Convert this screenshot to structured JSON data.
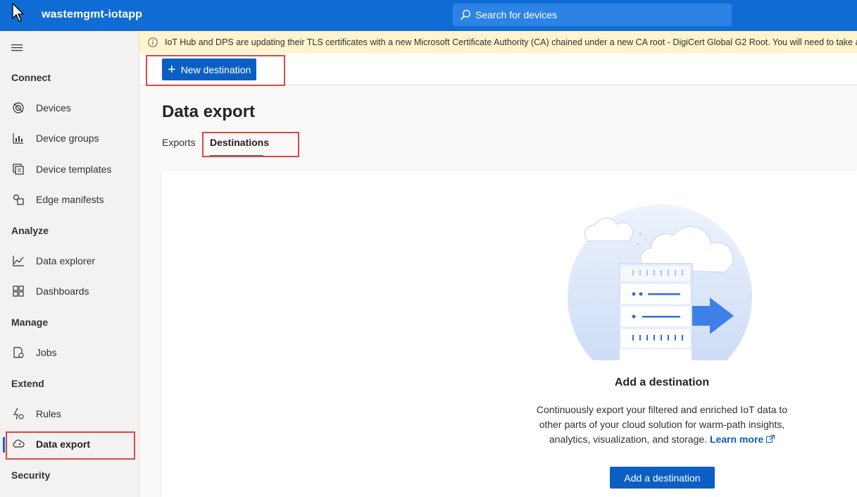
{
  "header": {
    "app_title": "wastemgmt-iotapp",
    "search_placeholder": "Search for devices"
  },
  "banner": {
    "text": "IoT Hub and DPS are updating their TLS certificates with a new Microsoft Certificate Authority (CA) chained under a new CA root - DigiCert Global G2 Root. You will need to take action to en"
  },
  "toolbar": {
    "new_destination_label": "New destination"
  },
  "sidebar": {
    "sections": {
      "connect": "Connect",
      "analyze": "Analyze",
      "manage": "Manage",
      "extend": "Extend",
      "security": "Security"
    },
    "items": [
      {
        "label": "Devices",
        "icon": "devices-icon"
      },
      {
        "label": "Device groups",
        "icon": "device-groups-icon"
      },
      {
        "label": "Device templates",
        "icon": "device-templates-icon"
      },
      {
        "label": "Edge manifests",
        "icon": "edge-manifests-icon"
      },
      {
        "label": "Data explorer",
        "icon": "data-explorer-icon"
      },
      {
        "label": "Dashboards",
        "icon": "dashboards-icon"
      },
      {
        "label": "Jobs",
        "icon": "jobs-icon"
      },
      {
        "label": "Rules",
        "icon": "rules-icon"
      },
      {
        "label": "Data export",
        "icon": "data-export-icon",
        "active": true
      }
    ]
  },
  "main": {
    "title": "Data export",
    "tabs": [
      {
        "label": "Exports"
      },
      {
        "label": "Destinations",
        "selected": true
      }
    ],
    "empty_state": {
      "title": "Add a destination",
      "description_line1": "Continuously export your filtered and enriched IoT data to",
      "description_line2": "other parts of your cloud solution for warm-path insights,",
      "description_line3": "analytics, visualization, and storage.",
      "learn_more": "Learn more",
      "button_label": "Add a destination"
    }
  },
  "colors": {
    "header_blue": "#0f6cd4",
    "primary_button": "#0b5fc4",
    "banner_yellow": "#fff4ce",
    "highlight_red": "#e04646"
  }
}
